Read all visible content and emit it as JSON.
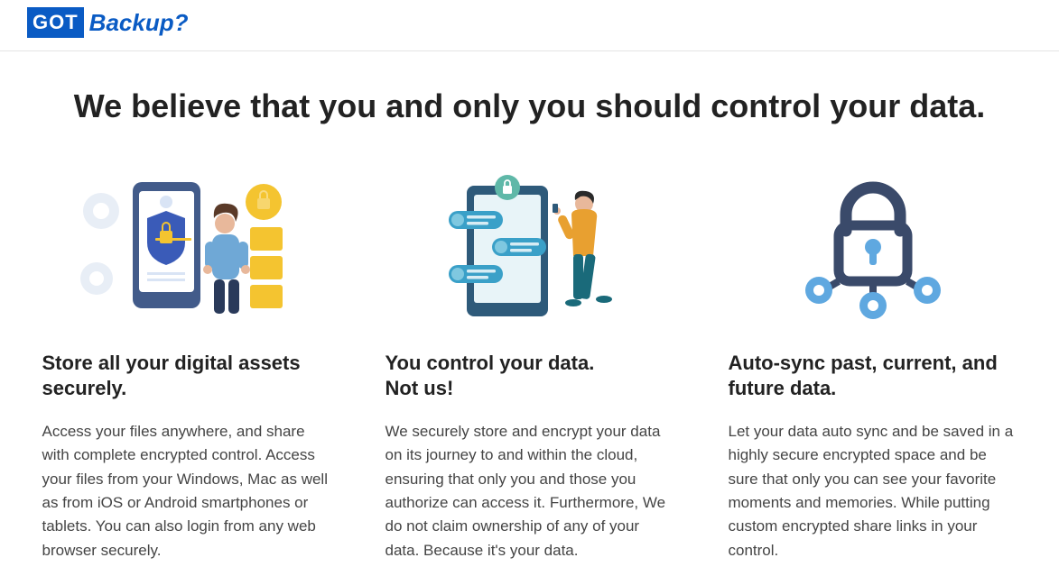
{
  "logo": {
    "badge": "GOT",
    "text": "Backup?"
  },
  "hero_title": "We believe that you and only you should control your data.",
  "features": [
    {
      "title": "Store all your digital assets securely.",
      "body": "Access your files anywhere, and share with complete encrypted control. Access your files from your Windows, Mac as well as from iOS or Android smartphones or tablets. You can also login from any web browser securely."
    },
    {
      "title": "You control your data.\nNot us!",
      "body": "We securely store and encrypt your data on its journey to and within the cloud, ensuring that only you and those you authorize can access it. Furthermore, We do not claim ownership of any of your data. Because it's your data."
    },
    {
      "title": "Auto-sync past, current, and future data.",
      "body": "Let your data auto sync and be saved in a highly secure encrypted space and be sure that only you can see your favorite moments and memories. While putting custom encrypted share links in your control."
    }
  ]
}
